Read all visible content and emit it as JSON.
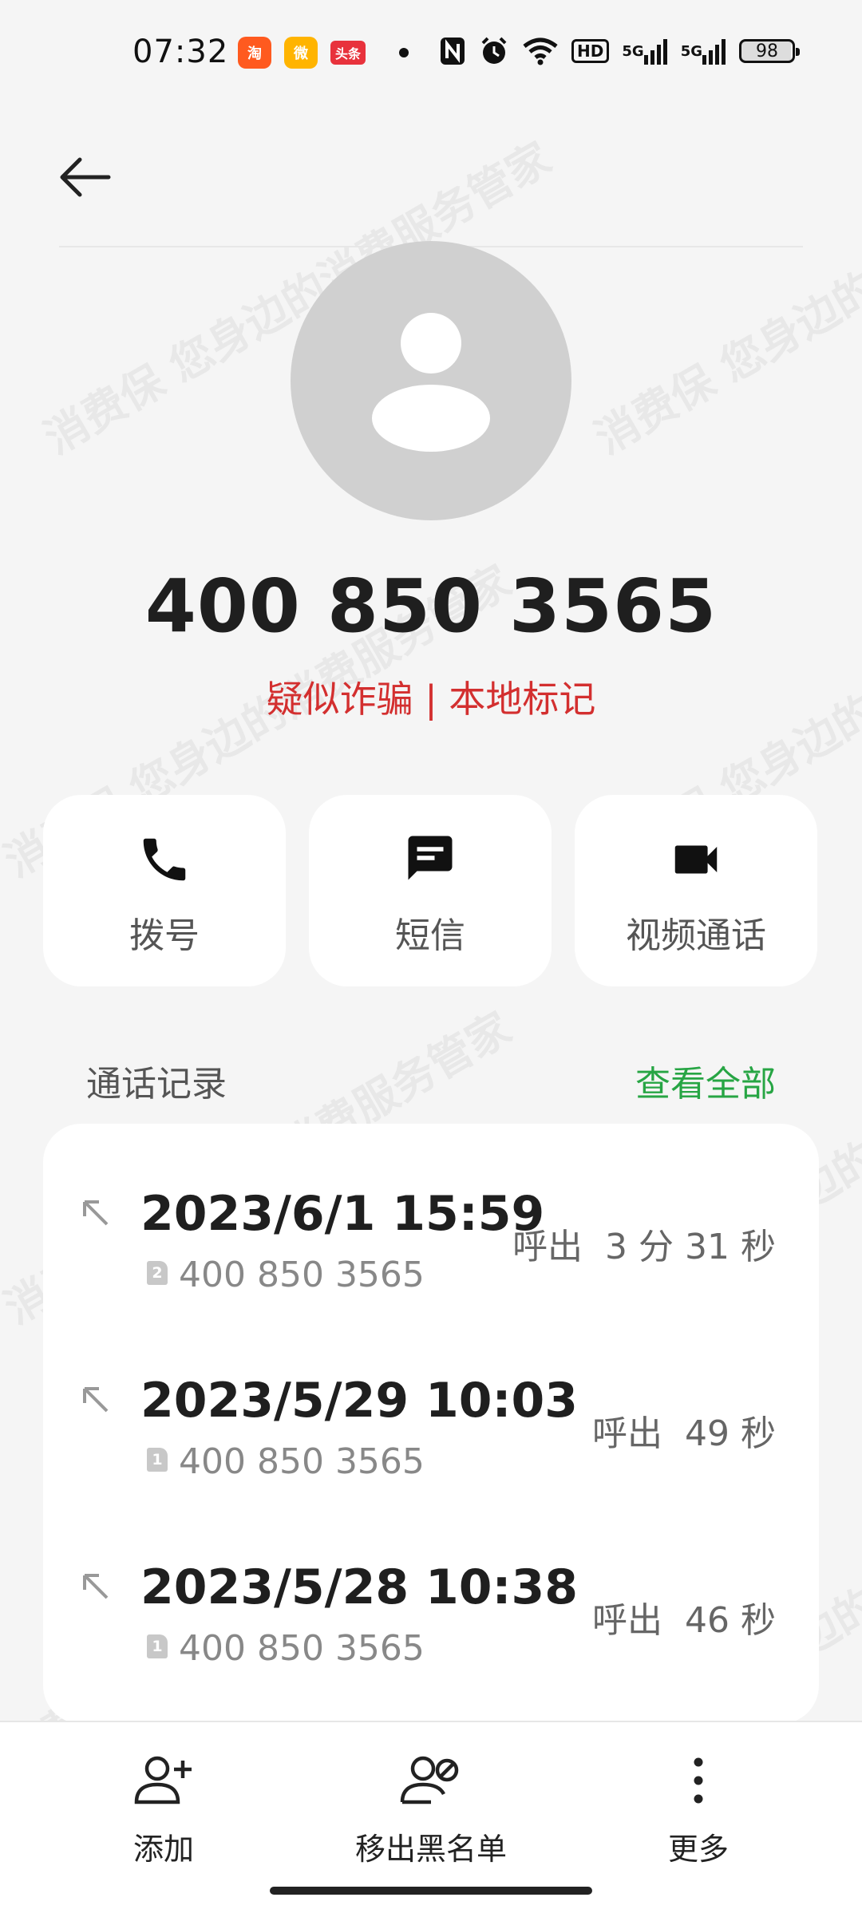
{
  "status_bar": {
    "time": "07:32",
    "apps": [
      {
        "name": "taobao-icon",
        "label": "淘"
      },
      {
        "name": "weibo-icon",
        "label": "微"
      },
      {
        "name": "toutiao-icon",
        "label": "头条"
      }
    ],
    "network": "5G",
    "hd_label": "HD",
    "battery": "98"
  },
  "contact": {
    "phone_number": "400 850 3565",
    "tag": "疑似诈骗 | 本地标记",
    "tag_color": "#d32f2f"
  },
  "actions": [
    {
      "icon": "phone-icon",
      "label": "拨号"
    },
    {
      "icon": "message-icon",
      "label": "短信"
    },
    {
      "icon": "video-icon",
      "label": "视频通话"
    }
  ],
  "call_history": {
    "title": "通话记录",
    "view_all": "查看全部",
    "accent": "#27a544",
    "calls": [
      {
        "datetime": "2023/6/1 15:59",
        "sim": "2",
        "number": "400 850 3565",
        "type": "呼出",
        "duration": "3 分 31 秒"
      },
      {
        "datetime": "2023/5/29 10:03",
        "sim": "1",
        "number": "400 850 3565",
        "type": "呼出",
        "duration": "49 秒"
      },
      {
        "datetime": "2023/5/28 10:38",
        "sim": "1",
        "number": "400 850 3565",
        "type": "呼出",
        "duration": "46 秒"
      }
    ]
  },
  "bottom_bar": {
    "add": "添加",
    "remove_blacklist": "移出黑名单",
    "more": "更多"
  },
  "watermark": "消费保 您身边的消费服务管家"
}
